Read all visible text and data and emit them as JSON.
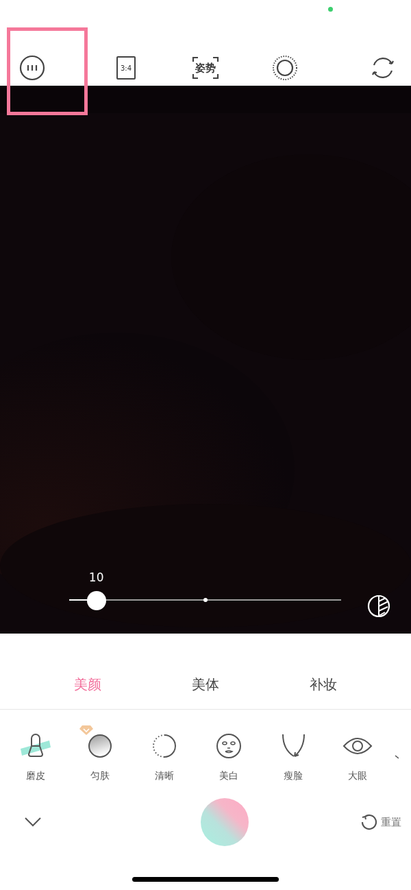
{
  "toolbar": [
    {
      "kind": "more",
      "highlighted": true
    },
    {
      "kind": "ratio",
      "label": "3:4",
      "highlighted": false
    },
    {
      "kind": "pose",
      "label": "姿势",
      "highlighted": false
    },
    {
      "kind": "shutter-mode",
      "highlighted": false
    },
    {
      "kind": "flip",
      "highlighted": false
    }
  ],
  "slider": {
    "reading": "10",
    "level": 0.1
  },
  "tabs": [
    {
      "label": "美颜",
      "selected": true
    },
    {
      "label": "美体",
      "selected": false
    },
    {
      "label": "补妆",
      "selected": false
    }
  ],
  "features": [
    {
      "kind": "smooth",
      "label": "磨皮",
      "premium": false
    },
    {
      "kind": "even",
      "label": "匀肤",
      "premium": true
    },
    {
      "kind": "sharpen",
      "label": "清晰",
      "premium": false
    },
    {
      "kind": "whiten",
      "label": "美白",
      "premium": false
    },
    {
      "kind": "slim",
      "label": "瘦脸",
      "premium": false
    },
    {
      "kind": "eye",
      "label": "大眼",
      "premium": false
    }
  ],
  "reset": {
    "label": "重置"
  }
}
